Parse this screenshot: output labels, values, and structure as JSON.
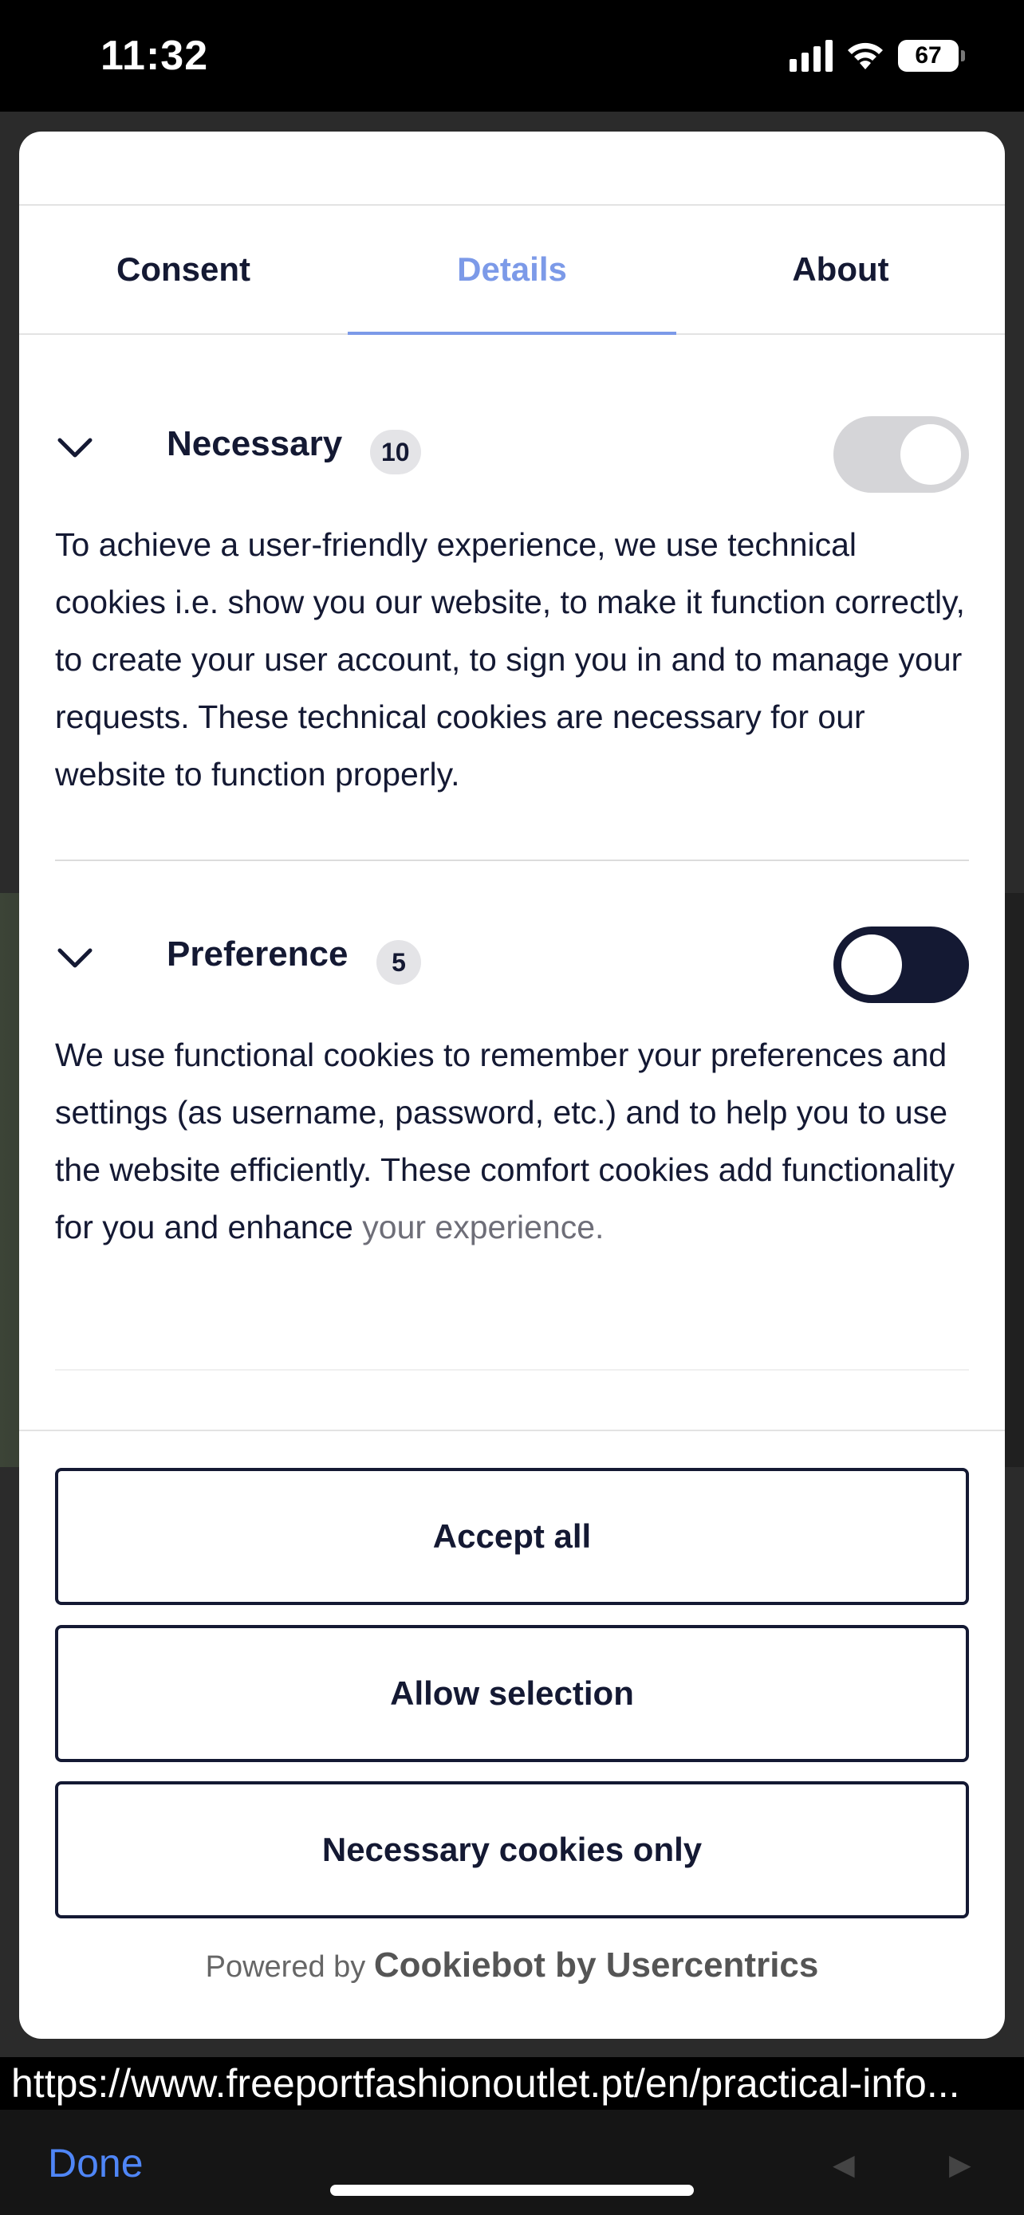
{
  "status_bar": {
    "time": "11:32",
    "battery": "67"
  },
  "tabs": [
    {
      "label": "Consent",
      "active": false
    },
    {
      "label": "Details",
      "active": true
    },
    {
      "label": "About",
      "active": false
    }
  ],
  "sections": [
    {
      "title": "Necessary",
      "count": "10",
      "toggle_state": "on-disabled",
      "description": "To achieve a user-friendly experience, we use technical cookies i.e. show you our website, to make it function correctly, to create your user account, to sign you in and to manage your requests. These technical cookies are necessary for our website to function properly."
    },
    {
      "title": "Preference",
      "count": "5",
      "toggle_state": "off",
      "description": "We use functional cookies to remember your preferences and settings (as username, password, etc.) and to help you to use the website efficiently. These comfort cookies add functionality for you and enhance",
      "description_faded": "your experience."
    }
  ],
  "buttons": {
    "accept_all": "Accept all",
    "allow_selection": "Allow selection",
    "necessary_only": "Necessary cookies only"
  },
  "powered_by": {
    "prefix": "Powered by",
    "brand": "Cookiebot by Usercentrics"
  },
  "browser": {
    "url": "https://www.freeportfashionoutlet.pt/en/practical-info...",
    "done_label": "Done",
    "back_arrow": "◀",
    "forward_arrow": "▶"
  },
  "colors": {
    "accent": "#7c9ae8",
    "text": "#141933",
    "link": "#4f86f7"
  }
}
